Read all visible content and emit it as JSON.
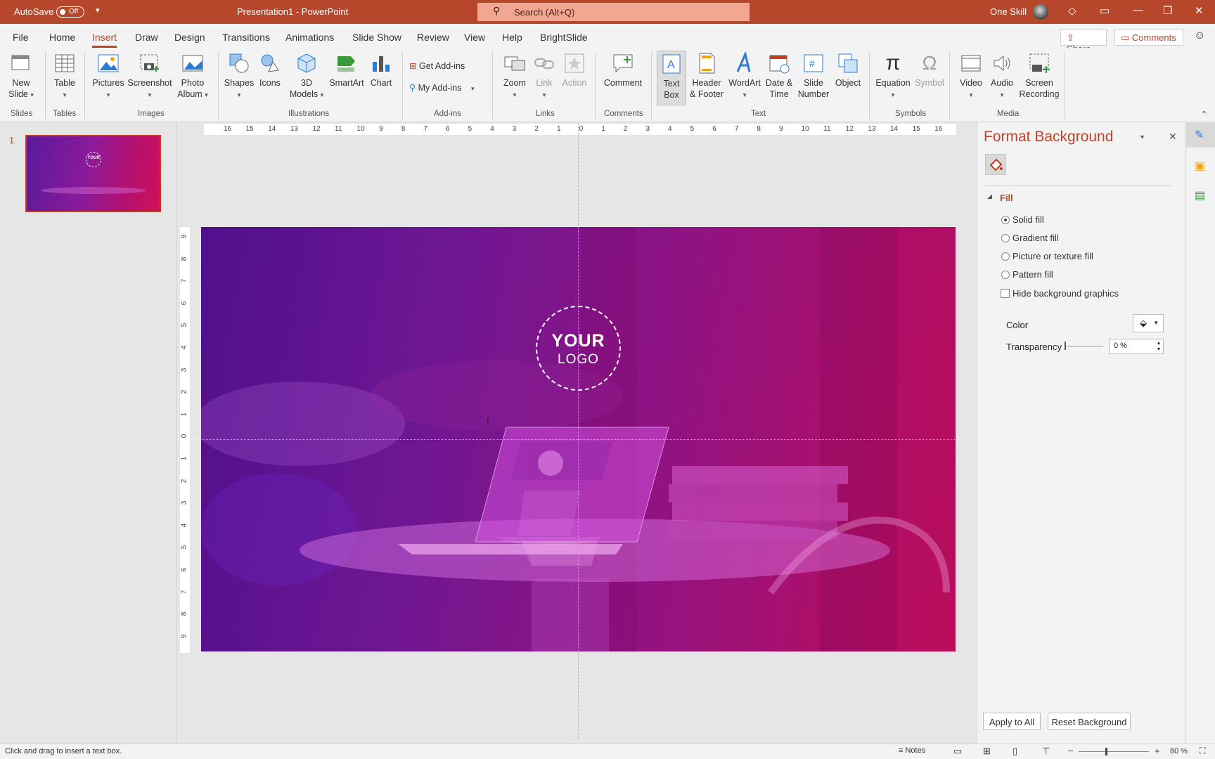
{
  "titlebar": {
    "autosave_label": "AutoSave",
    "autosave_state": "Off",
    "doc_title": "Presentation1  -  PowerPoint",
    "search_placeholder": "Search (Alt+Q)",
    "user_name": "One Skill"
  },
  "tabs": [
    "File",
    "Home",
    "Insert",
    "Draw",
    "Design",
    "Transitions",
    "Animations",
    "Slide Show",
    "Review",
    "View",
    "Help",
    "BrightSlide"
  ],
  "active_tab": "Insert",
  "share_label": "Share",
  "comments_label": "Comments",
  "ribbon": {
    "new_slide": [
      "New",
      "Slide"
    ],
    "table": "Table",
    "pictures": "Pictures",
    "screenshot": "Screenshot",
    "photo_album": [
      "Photo",
      "Album"
    ],
    "shapes": "Shapes",
    "icons": "Icons",
    "models3d": [
      "3D",
      "Models"
    ],
    "smartart": "SmartArt",
    "chart": "Chart",
    "get_addins": "Get Add-ins",
    "my_addins": "My Add-ins",
    "zoom": "Zoom",
    "link": "Link",
    "action": "Action",
    "comment": "Comment",
    "text_box": [
      "Text",
      "Box"
    ],
    "header_footer": [
      "Header",
      "& Footer"
    ],
    "wordart": "WordArt",
    "date_time": [
      "Date &",
      "Time"
    ],
    "slide_number": [
      "Slide",
      "Number"
    ],
    "object": "Object",
    "equation": "Equation",
    "symbol": "Symbol",
    "video": "Video",
    "audio": "Audio",
    "screen_recording": [
      "Screen",
      "Recording"
    ],
    "groups": [
      "Slides",
      "Tables",
      "Images",
      "Illustrations",
      "Add-ins",
      "Links",
      "Comments",
      "Text",
      "Symbols",
      "Media"
    ]
  },
  "slide_panel": {
    "slide_number": "1"
  },
  "ruler_h": [
    "16",
    "15",
    "14",
    "13",
    "12",
    "11",
    "10",
    "9",
    "8",
    "7",
    "6",
    "5",
    "4",
    "3",
    "2",
    "1",
    "0",
    "1",
    "2",
    "3",
    "4",
    "5",
    "6",
    "7",
    "8",
    "9",
    "10",
    "11",
    "12",
    "13",
    "14",
    "15",
    "16"
  ],
  "ruler_v": [
    "9",
    "8",
    "7",
    "6",
    "5",
    "4",
    "3",
    "2",
    "1",
    "0",
    "1",
    "2",
    "3",
    "4",
    "5",
    "6",
    "7",
    "8",
    "9"
  ],
  "slide": {
    "logo_line1": "YOUR",
    "logo_line2": "LOGO"
  },
  "format_pane": {
    "title": "Format Background",
    "section": "Fill",
    "options": [
      "Solid fill",
      "Gradient fill",
      "Picture or texture fill",
      "Pattern fill"
    ],
    "selected_option": "Solid fill",
    "hide_graphics": "Hide background graphics",
    "color_label": "Color",
    "transparency_label": "Transparency",
    "transparency_value": "0 %",
    "apply_all": "Apply to All",
    "reset": "Reset Background"
  },
  "statusbar": {
    "hint": "Click and drag to insert a text box.",
    "notes": "Notes",
    "zoom": "80 %"
  },
  "colors": {
    "accent": "#b7472a",
    "slide_left": "#57139a",
    "slide_right": "#d41060"
  }
}
